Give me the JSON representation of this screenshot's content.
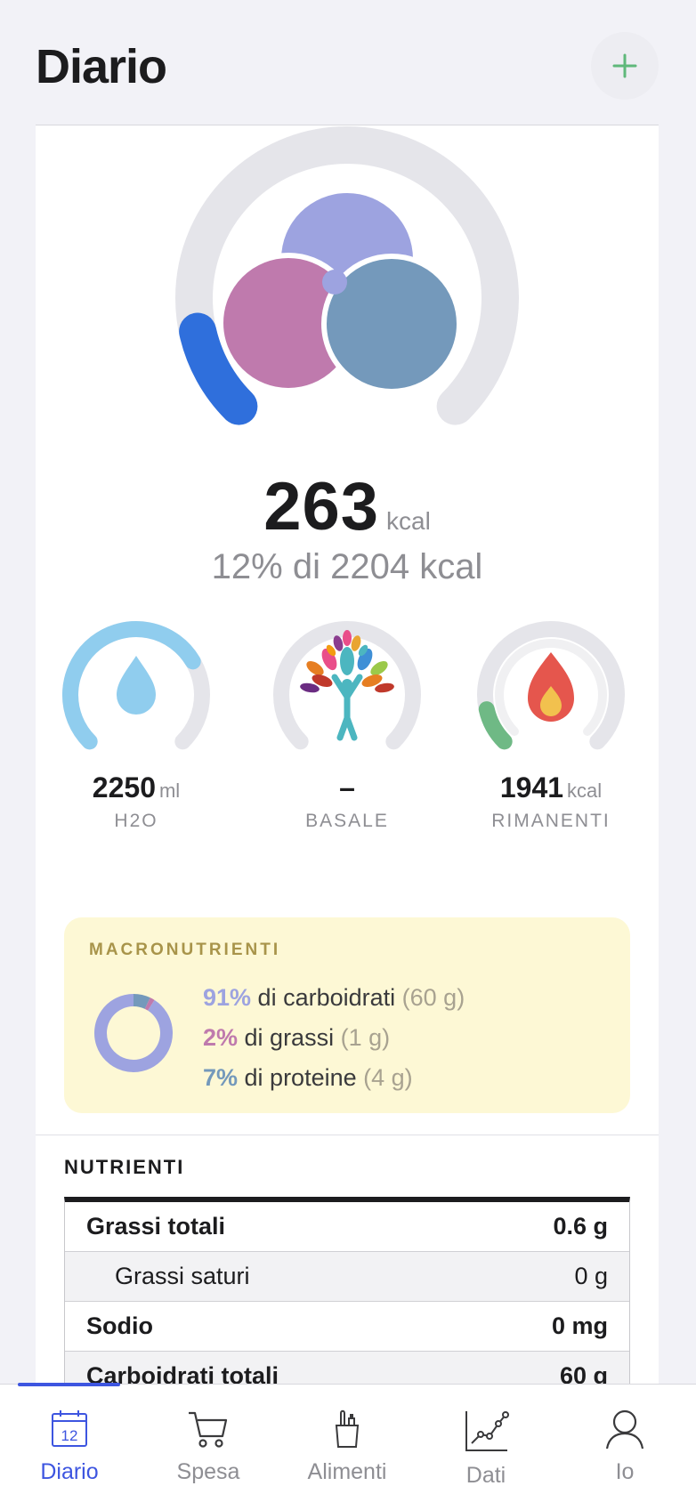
{
  "header": {
    "title": "Diario",
    "add_icon": "plus-icon",
    "accent": "#5fb87a"
  },
  "energy": {
    "value": "263",
    "unit": "kcal",
    "subtitle": "12% di 2204 kcal",
    "progress": 0.12,
    "ring_color": "#2f6fdc",
    "logo_colors": [
      "#9da3e0",
      "#bf7aad",
      "#7499bb"
    ]
  },
  "gauges": [
    {
      "id": "water",
      "value": "2250",
      "unit": "ml",
      "label": "H2O",
      "progress": 0.72,
      "color": "#90cdee",
      "icon": "water-drop-icon"
    },
    {
      "id": "basal",
      "value": "–",
      "unit": "",
      "label": "BASALE",
      "progress": 0,
      "color": "#e5e5ea",
      "icon": "tree-person-icon"
    },
    {
      "id": "remaining",
      "value": "1941",
      "unit": "kcal",
      "label": "RIMANENTI",
      "progress": 0.12,
      "color": "#6fb985",
      "icon": "flame-icon"
    }
  ],
  "macro": {
    "title": "MACRONUTRIENTI",
    "items": [
      {
        "pct": "91%",
        "text": " di carboidrati",
        "grams": "(60 g)",
        "color": "#9da3e0",
        "fraction": 0.91
      },
      {
        "pct": "2%",
        "text": " di grassi",
        "grams": "(1 g)",
        "color": "#bf7aad",
        "fraction": 0.02
      },
      {
        "pct": "7%",
        "text": " di proteine",
        "grams": "(4 g)",
        "color": "#7499bb",
        "fraction": 0.07
      }
    ]
  },
  "nutrients": {
    "title": "NUTRIENTI",
    "rows": [
      {
        "label": "Grassi totali",
        "value": "0.6 g"
      },
      {
        "label": "Grassi saturi",
        "value": "0 g"
      },
      {
        "label": "Sodio",
        "value": "0 mg"
      },
      {
        "label": "Carboidrati totali",
        "value": "60 g"
      }
    ]
  },
  "tabs": [
    {
      "label": "Diario",
      "icon": "calendar-icon",
      "active": true,
      "calendar_day": "12"
    },
    {
      "label": "Spesa",
      "icon": "cart-icon",
      "active": false
    },
    {
      "label": "Alimenti",
      "icon": "groceries-icon",
      "active": false
    },
    {
      "label": "Dati",
      "icon": "chart-icon",
      "active": false
    },
    {
      "label": "Io",
      "icon": "person-icon",
      "active": false
    }
  ],
  "tab_active_color": "#3d55e0"
}
